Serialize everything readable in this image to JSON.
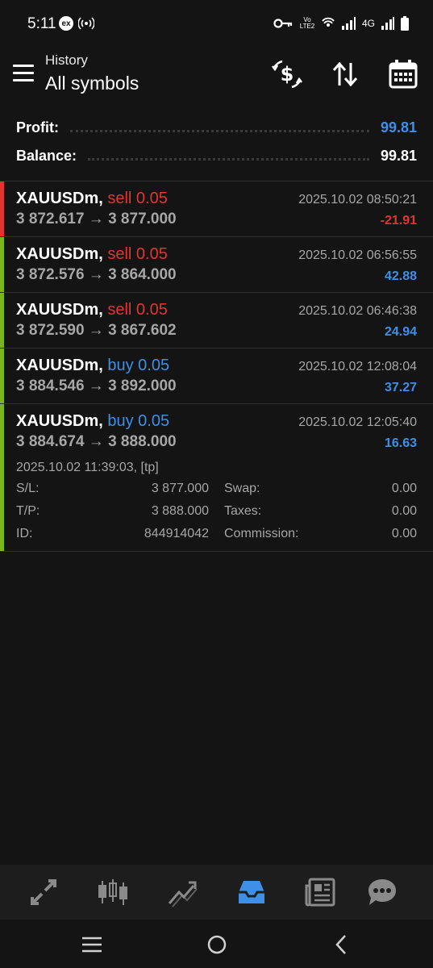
{
  "status_bar": {
    "time": "5:11",
    "left_icons": [
      "ex-badge-icon",
      "hotspot-icon"
    ],
    "volte": "Vo LTE2",
    "network": "4G",
    "right_icons": [
      "key-icon",
      "volte-icon",
      "wifi-calling-icon",
      "signal-icon",
      "network-4g-icon",
      "battery-icon"
    ]
  },
  "header": {
    "subtitle": "History",
    "title": "All symbols",
    "actions": [
      "currency-exchange-icon",
      "sort-icon",
      "calendar-icon"
    ]
  },
  "summary": {
    "profit_label": "Profit:",
    "profit_value": "99.81",
    "balance_label": "Balance:",
    "balance_value": "99.81"
  },
  "colors": {
    "sell": "#e3342f",
    "buy": "#3d8fe8",
    "loss_bar": "#e3342f",
    "profit_bar": "#7cb518"
  },
  "trades": [
    {
      "symbol": "XAUUSDm,",
      "side": "sell 0.05",
      "side_type": "sell",
      "prices": "3 872.617 → 3 877.000",
      "time": "2025.10.02 08:50:21",
      "profit": "-21.91",
      "profit_type": "loss"
    },
    {
      "symbol": "XAUUSDm,",
      "side": "sell 0.05",
      "side_type": "sell",
      "prices": "3 872.576 → 3 864.000",
      "time": "2025.10.02 06:56:55",
      "profit": "42.88",
      "profit_type": "gain"
    },
    {
      "symbol": "XAUUSDm,",
      "side": "sell 0.05",
      "side_type": "sell",
      "prices": "3 872.590 → 3 867.602",
      "time": "2025.10.02 06:46:38",
      "profit": "24.94",
      "profit_type": "gain"
    },
    {
      "symbol": "XAUUSDm,",
      "side": "buy 0.05",
      "side_type": "buy",
      "prices": "3 884.546 → 3 892.000",
      "time": "2025.10.02 12:08:04",
      "profit": "37.27",
      "profit_type": "gain"
    },
    {
      "symbol": "XAUUSDm,",
      "side": "buy 0.05",
      "side_type": "buy",
      "prices": "3 884.674 → 3 888.000",
      "time": "2025.10.02 12:05:40",
      "profit": "16.63",
      "profit_type": "gain"
    }
  ],
  "expanded_detail": {
    "open_time": "2025.10.02 11:39:03, [tp]",
    "sl_label": "S/L:",
    "sl_value": "3 877.000",
    "swap_label": "Swap:",
    "swap_value": "0.00",
    "tp_label": "T/P:",
    "tp_value": "3 888.000",
    "taxes_label": "Taxes:",
    "taxes_value": "0.00",
    "id_label": "ID:",
    "id_value": "844914042",
    "commission_label": "Commission:",
    "commission_value": "0.00"
  },
  "bottom_nav": {
    "items": [
      "quotes-icon",
      "chart-icon",
      "trade-icon",
      "history-icon",
      "news-icon",
      "messages-icon"
    ],
    "active": "history-icon"
  },
  "system_nav": [
    "recents-icon",
    "home-icon",
    "back-icon"
  ]
}
